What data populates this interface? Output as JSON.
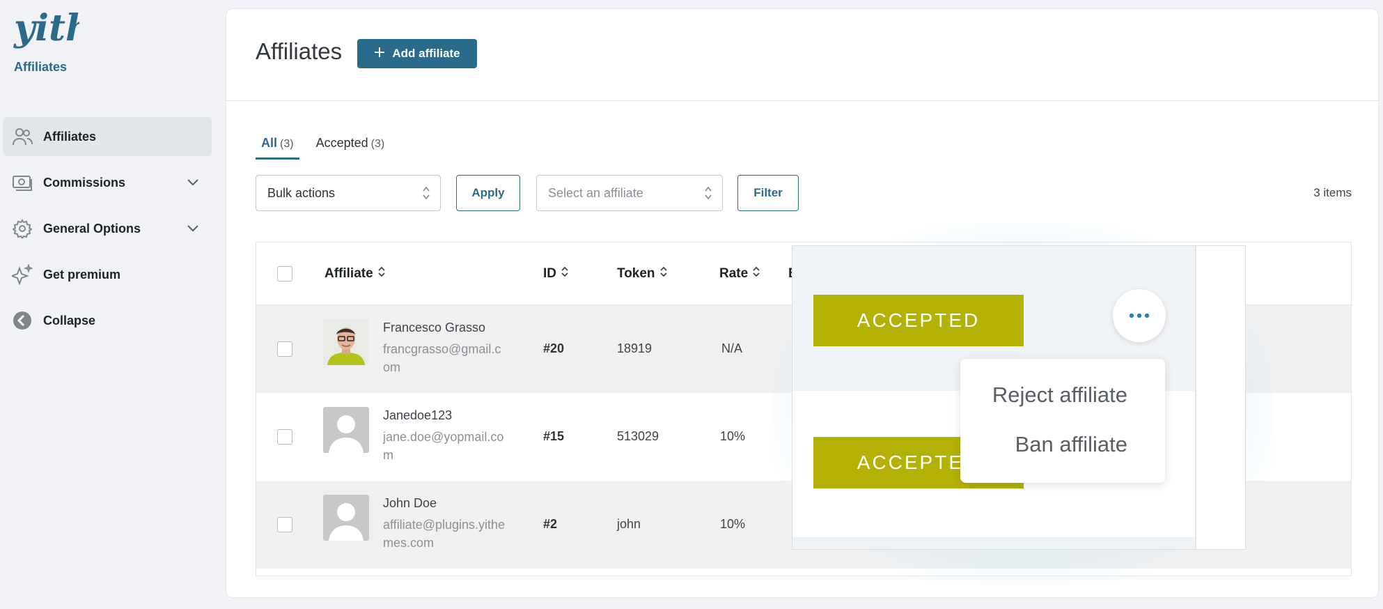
{
  "brand": {
    "logo_text": "yith",
    "subtitle": "Affiliates",
    "color": "#2a6a8b"
  },
  "sidebar": {
    "items": [
      {
        "label": "Affiliates",
        "icon": "users-icon",
        "active": true
      },
      {
        "label": "Commissions",
        "icon": "money-icon",
        "expandable": true
      },
      {
        "label": "General Options",
        "icon": "gear-icon",
        "expandable": true
      },
      {
        "label": "Get premium",
        "icon": "sparkle-icon"
      },
      {
        "label": "Collapse",
        "icon": "collapse-arrow-icon"
      }
    ]
  },
  "header": {
    "title": "Affiliates",
    "add_button": "Add affiliate"
  },
  "tabs": [
    {
      "label": "All",
      "count": "(3)",
      "active": true
    },
    {
      "label": "Accepted",
      "count": "(3)"
    }
  ],
  "toolbar": {
    "bulk_actions": "Bulk actions",
    "apply": "Apply",
    "select_affiliate_placeholder": "Select an affiliate",
    "filter": "Filter",
    "items_count": "3 items"
  },
  "table": {
    "columns": {
      "affiliate": "Affiliate",
      "id": "ID",
      "token": "Token",
      "rate": "Rate",
      "partial": "E"
    },
    "rows": [
      {
        "name": "Francesco Grasso",
        "email": "francgrasso@gmail.com",
        "id": "#20",
        "token": "18919",
        "rate": "N/A"
      },
      {
        "name": "Janedoe123",
        "email": "jane.doe@yopmail.com",
        "id": "#15",
        "token": "513029",
        "rate": "10%"
      },
      {
        "name": "John Doe",
        "email": "affiliate@plugins.yithemes.com",
        "id": "#2",
        "token": "john",
        "rate": "10%"
      }
    ]
  },
  "popup": {
    "status_label": "ACCEPTED",
    "status_color": "#b3b103",
    "menu": [
      "Reject affiliate",
      "Ban affiliate"
    ]
  }
}
